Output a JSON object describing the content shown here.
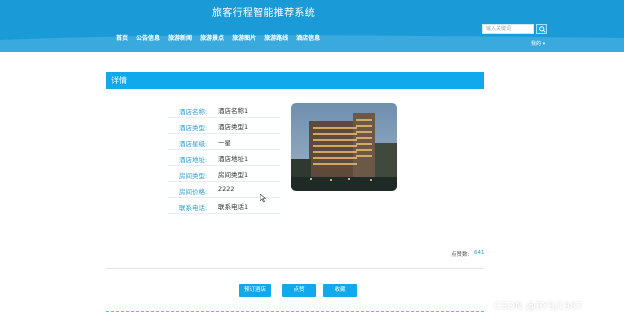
{
  "header": {
    "site_title": "旅客行程智能推荐系统",
    "nav": [
      "首页",
      "公告信息",
      "旅游新闻",
      "旅游景点",
      "旅游图片",
      "旅游路线",
      "酒店信息"
    ],
    "search_placeholder": "输入关键词",
    "user_menu": "我的 ▾"
  },
  "panel": {
    "title": "详情",
    "fields": [
      {
        "label": "酒店名称:",
        "value": "酒店名称1"
      },
      {
        "label": "酒店类型:",
        "value": "酒店类型1"
      },
      {
        "label": "酒店星级:",
        "value": "一星"
      },
      {
        "label": "酒店地址:",
        "value": "酒店地址1"
      },
      {
        "label": "房间类型:",
        "value": "房间类型1"
      },
      {
        "label": "房间价格:",
        "value": "2222"
      },
      {
        "label": "联系电话:",
        "value": "联系电话1"
      }
    ],
    "views_label": "点赞数:",
    "views_value": "641",
    "buttons": [
      "预订酒店",
      "点赞",
      "收藏"
    ]
  },
  "watermark": "CSDN @BYSJ1987",
  "colors": {
    "primary": "#1a9bd7",
    "accent": "#0fa9ec",
    "label": "#2b9fd0"
  }
}
